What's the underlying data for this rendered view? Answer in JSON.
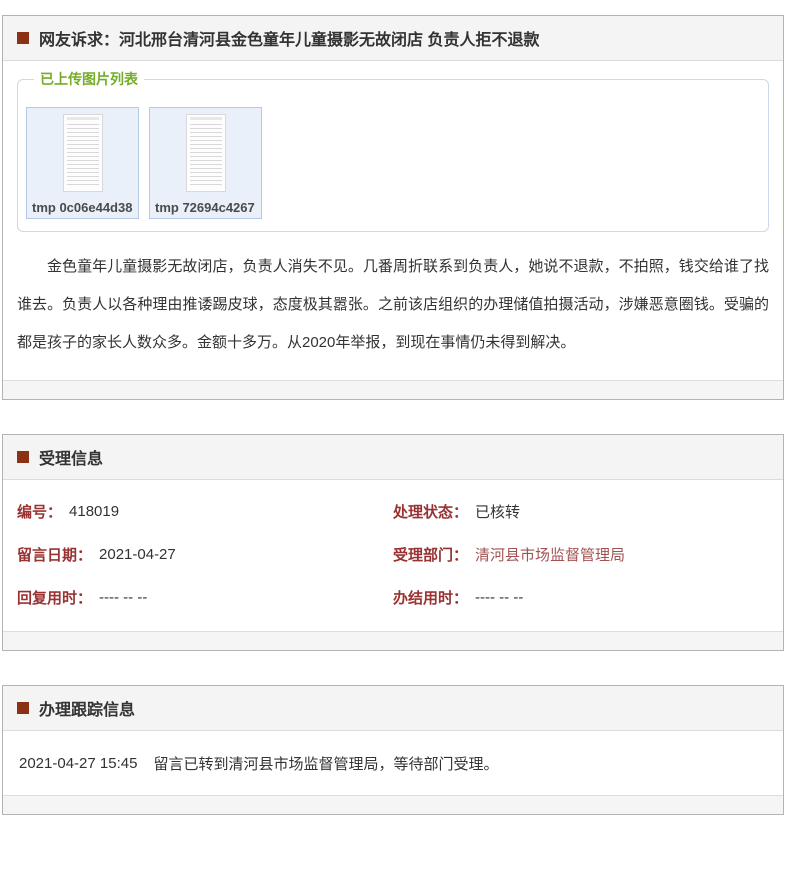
{
  "colors": {
    "bullet_accent": "#8c3214",
    "field_label": "#993333",
    "department_link": "#a35252",
    "fieldset_legend_green": "#74ad28",
    "header_bar_gray": "#f4f4f4"
  },
  "complaint": {
    "title": "网友诉求：河北邢台清河县金色童年儿童摄影无故闭店 负责人拒不退款",
    "uploaded_images": {
      "legend": "已上传图片列表",
      "items": [
        {
          "caption": "tmp 0c06e44d38"
        },
        {
          "caption": "tmp 72694c4267"
        }
      ]
    },
    "body": "金色童年儿童摄影无故闭店，负责人消失不见。几番周折联系到负责人，她说不退款，不拍照，钱交给谁了找谁去。负责人以各种理由推诿踢皮球，态度极其嚣张。之前该店组织的办理储值拍摄活动，涉嫌恶意圈钱。受骗的都是孩子的家长人数众多。金额十多万。从2020年举报，到现在事情仍未得到解决。"
  },
  "acceptance": {
    "title": "受理信息",
    "rows": [
      {
        "left": {
          "label": "编号：",
          "value": "418019"
        },
        "right": {
          "label": "处理状态：",
          "value": "已核转"
        }
      },
      {
        "left": {
          "label": "留言日期：",
          "value": "2021-04-27"
        },
        "right": {
          "label": "受理部门：",
          "value": "清河县市场监督管理局"
        }
      },
      {
        "left": {
          "label": "回复用时：",
          "value": "---- -- --"
        },
        "right": {
          "label": "办结用时：",
          "value": "---- -- --"
        }
      }
    ]
  },
  "tracking": {
    "title": "办理跟踪信息",
    "records": [
      {
        "time": "2021-04-27 15:45",
        "text": "留言已转到清河县市场监督管理局，等待部门受理。"
      }
    ]
  }
}
